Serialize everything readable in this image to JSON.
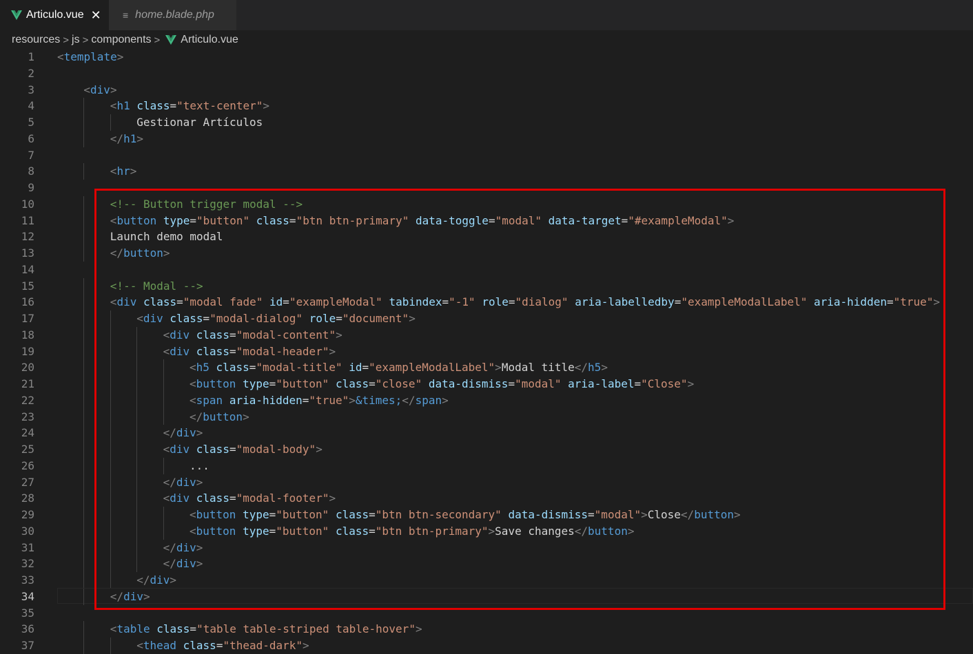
{
  "tabs": [
    {
      "label": "Articulo.vue",
      "icon": "vue-icon",
      "active": true
    },
    {
      "label": "home.blade.php",
      "icon": "lines-icon",
      "active": false
    }
  ],
  "breadcrumb": {
    "items": [
      "resources",
      "js",
      "components",
      "Articulo.vue"
    ],
    "separator": ">"
  },
  "editor": {
    "active_line": 34,
    "lines": [
      {
        "n": "1",
        "indent": 0,
        "tokens": [
          [
            "t",
            "<"
          ],
          [
            "tn",
            "template"
          ],
          [
            "t",
            ">"
          ]
        ]
      },
      {
        "n": "2",
        "indent": 0,
        "tokens": []
      },
      {
        "n": "3",
        "indent": 1,
        "tokens": [
          [
            "t",
            "<"
          ],
          [
            "tn",
            "div"
          ],
          [
            "t",
            ">"
          ]
        ]
      },
      {
        "n": "4",
        "indent": 2,
        "tokens": [
          [
            "t",
            "<"
          ],
          [
            "tn",
            "h1"
          ],
          [
            "p",
            " "
          ],
          [
            "a",
            "class"
          ],
          [
            "p",
            "="
          ],
          [
            "s",
            "\"text-center\""
          ],
          [
            "t",
            ">"
          ]
        ]
      },
      {
        "n": "5",
        "indent": 3,
        "tokens": [
          [
            "p",
            "Gestionar Artículos"
          ]
        ]
      },
      {
        "n": "6",
        "indent": 2,
        "tokens": [
          [
            "t",
            "</"
          ],
          [
            "tn",
            "h1"
          ],
          [
            "t",
            ">"
          ]
        ]
      },
      {
        "n": "7",
        "indent": 0,
        "tokens": []
      },
      {
        "n": "8",
        "indent": 2,
        "tokens": [
          [
            "t",
            "<"
          ],
          [
            "tn",
            "hr"
          ],
          [
            "t",
            ">"
          ]
        ]
      },
      {
        "n": "9",
        "indent": 0,
        "tokens": []
      },
      {
        "n": "10",
        "indent": 2,
        "tokens": [
          [
            "c",
            "<!-- Button trigger modal -->"
          ]
        ]
      },
      {
        "n": "11",
        "indent": 2,
        "tokens": [
          [
            "t",
            "<"
          ],
          [
            "tn",
            "button"
          ],
          [
            "p",
            " "
          ],
          [
            "a",
            "type"
          ],
          [
            "p",
            "="
          ],
          [
            "s",
            "\"button\""
          ],
          [
            "p",
            " "
          ],
          [
            "a",
            "class"
          ],
          [
            "p",
            "="
          ],
          [
            "s",
            "\"btn btn-primary\""
          ],
          [
            "p",
            " "
          ],
          [
            "a",
            "data-toggle"
          ],
          [
            "p",
            "="
          ],
          [
            "s",
            "\"modal\""
          ],
          [
            "p",
            " "
          ],
          [
            "a",
            "data-target"
          ],
          [
            "p",
            "="
          ],
          [
            "s",
            "\"#exampleModal\""
          ],
          [
            "t",
            ">"
          ]
        ]
      },
      {
        "n": "12",
        "indent": 2,
        "tokens": [
          [
            "p",
            "Launch demo modal"
          ]
        ]
      },
      {
        "n": "13",
        "indent": 2,
        "tokens": [
          [
            "t",
            "</"
          ],
          [
            "tn",
            "button"
          ],
          [
            "t",
            ">"
          ]
        ]
      },
      {
        "n": "14",
        "indent": 0,
        "tokens": []
      },
      {
        "n": "15",
        "indent": 2,
        "tokens": [
          [
            "c",
            "<!-- Modal -->"
          ]
        ]
      },
      {
        "n": "16",
        "indent": 2,
        "tokens": [
          [
            "t",
            "<"
          ],
          [
            "tn",
            "div"
          ],
          [
            "p",
            " "
          ],
          [
            "a",
            "class"
          ],
          [
            "p",
            "="
          ],
          [
            "s",
            "\"modal fade\""
          ],
          [
            "p",
            " "
          ],
          [
            "a",
            "id"
          ],
          [
            "p",
            "="
          ],
          [
            "s",
            "\"exampleModal\""
          ],
          [
            "p",
            " "
          ],
          [
            "a",
            "tabindex"
          ],
          [
            "p",
            "="
          ],
          [
            "s",
            "\"-1\""
          ],
          [
            "p",
            " "
          ],
          [
            "a",
            "role"
          ],
          [
            "p",
            "="
          ],
          [
            "s",
            "\"dialog\""
          ],
          [
            "p",
            " "
          ],
          [
            "a",
            "aria-labelledby"
          ],
          [
            "p",
            "="
          ],
          [
            "s",
            "\"exampleModalLabel\""
          ],
          [
            "p",
            " "
          ],
          [
            "a",
            "aria-hidden"
          ],
          [
            "p",
            "="
          ],
          [
            "s",
            "\"true\""
          ],
          [
            "t",
            ">"
          ]
        ]
      },
      {
        "n": "17",
        "indent": 3,
        "tokens": [
          [
            "t",
            "<"
          ],
          [
            "tn",
            "div"
          ],
          [
            "p",
            " "
          ],
          [
            "a",
            "class"
          ],
          [
            "p",
            "="
          ],
          [
            "s",
            "\"modal-dialog\""
          ],
          [
            "p",
            " "
          ],
          [
            "a",
            "role"
          ],
          [
            "p",
            "="
          ],
          [
            "s",
            "\"document\""
          ],
          [
            "t",
            ">"
          ]
        ]
      },
      {
        "n": "18",
        "indent": 4,
        "tokens": [
          [
            "t",
            "<"
          ],
          [
            "tn",
            "div"
          ],
          [
            "p",
            " "
          ],
          [
            "a",
            "class"
          ],
          [
            "p",
            "="
          ],
          [
            "s",
            "\"modal-content\""
          ],
          [
            "t",
            ">"
          ]
        ]
      },
      {
        "n": "19",
        "indent": 4,
        "tokens": [
          [
            "t",
            "<"
          ],
          [
            "tn",
            "div"
          ],
          [
            "p",
            " "
          ],
          [
            "a",
            "class"
          ],
          [
            "p",
            "="
          ],
          [
            "s",
            "\"modal-header\""
          ],
          [
            "t",
            ">"
          ]
        ]
      },
      {
        "n": "20",
        "indent": 5,
        "tokens": [
          [
            "t",
            "<"
          ],
          [
            "tn",
            "h5"
          ],
          [
            "p",
            " "
          ],
          [
            "a",
            "class"
          ],
          [
            "p",
            "="
          ],
          [
            "s",
            "\"modal-title\""
          ],
          [
            "p",
            " "
          ],
          [
            "a",
            "id"
          ],
          [
            "p",
            "="
          ],
          [
            "s",
            "\"exampleModalLabel\""
          ],
          [
            "t",
            ">"
          ],
          [
            "p",
            "Modal title"
          ],
          [
            "t",
            "</"
          ],
          [
            "tn",
            "h5"
          ],
          [
            "t",
            ">"
          ]
        ]
      },
      {
        "n": "21",
        "indent": 5,
        "tokens": [
          [
            "t",
            "<"
          ],
          [
            "tn",
            "button"
          ],
          [
            "p",
            " "
          ],
          [
            "a",
            "type"
          ],
          [
            "p",
            "="
          ],
          [
            "s",
            "\"button\""
          ],
          [
            "p",
            " "
          ],
          [
            "a",
            "class"
          ],
          [
            "p",
            "="
          ],
          [
            "s",
            "\"close\""
          ],
          [
            "p",
            " "
          ],
          [
            "a",
            "data-dismiss"
          ],
          [
            "p",
            "="
          ],
          [
            "s",
            "\"modal\""
          ],
          [
            "p",
            " "
          ],
          [
            "a",
            "aria-label"
          ],
          [
            "p",
            "="
          ],
          [
            "s",
            "\"Close\""
          ],
          [
            "t",
            ">"
          ]
        ]
      },
      {
        "n": "22",
        "indent": 5,
        "tokens": [
          [
            "t",
            "<"
          ],
          [
            "tn",
            "span"
          ],
          [
            "p",
            " "
          ],
          [
            "a",
            "aria-hidden"
          ],
          [
            "p",
            "="
          ],
          [
            "s",
            "\"true\""
          ],
          [
            "t",
            ">"
          ],
          [
            "e",
            "&times;"
          ],
          [
            "t",
            "</"
          ],
          [
            "tn",
            "span"
          ],
          [
            "t",
            ">"
          ]
        ]
      },
      {
        "n": "23",
        "indent": 5,
        "tokens": [
          [
            "t",
            "</"
          ],
          [
            "tn",
            "button"
          ],
          [
            "t",
            ">"
          ]
        ]
      },
      {
        "n": "24",
        "indent": 4,
        "tokens": [
          [
            "t",
            "</"
          ],
          [
            "tn",
            "div"
          ],
          [
            "t",
            ">"
          ]
        ]
      },
      {
        "n": "25",
        "indent": 4,
        "tokens": [
          [
            "t",
            "<"
          ],
          [
            "tn",
            "div"
          ],
          [
            "p",
            " "
          ],
          [
            "a",
            "class"
          ],
          [
            "p",
            "="
          ],
          [
            "s",
            "\"modal-body\""
          ],
          [
            "t",
            ">"
          ]
        ]
      },
      {
        "n": "26",
        "indent": 5,
        "tokens": [
          [
            "p",
            "..."
          ]
        ]
      },
      {
        "n": "27",
        "indent": 4,
        "tokens": [
          [
            "t",
            "</"
          ],
          [
            "tn",
            "div"
          ],
          [
            "t",
            ">"
          ]
        ]
      },
      {
        "n": "28",
        "indent": 4,
        "tokens": [
          [
            "t",
            "<"
          ],
          [
            "tn",
            "div"
          ],
          [
            "p",
            " "
          ],
          [
            "a",
            "class"
          ],
          [
            "p",
            "="
          ],
          [
            "s",
            "\"modal-footer\""
          ],
          [
            "t",
            ">"
          ]
        ]
      },
      {
        "n": "29",
        "indent": 5,
        "tokens": [
          [
            "t",
            "<"
          ],
          [
            "tn",
            "button"
          ],
          [
            "p",
            " "
          ],
          [
            "a",
            "type"
          ],
          [
            "p",
            "="
          ],
          [
            "s",
            "\"button\""
          ],
          [
            "p",
            " "
          ],
          [
            "a",
            "class"
          ],
          [
            "p",
            "="
          ],
          [
            "s",
            "\"btn btn-secondary\""
          ],
          [
            "p",
            " "
          ],
          [
            "a",
            "data-dismiss"
          ],
          [
            "p",
            "="
          ],
          [
            "s",
            "\"modal\""
          ],
          [
            "t",
            ">"
          ],
          [
            "p",
            "Close"
          ],
          [
            "t",
            "</"
          ],
          [
            "tn",
            "button"
          ],
          [
            "t",
            ">"
          ]
        ]
      },
      {
        "n": "30",
        "indent": 5,
        "tokens": [
          [
            "t",
            "<"
          ],
          [
            "tn",
            "button"
          ],
          [
            "p",
            " "
          ],
          [
            "a",
            "type"
          ],
          [
            "p",
            "="
          ],
          [
            "s",
            "\"button\""
          ],
          [
            "p",
            " "
          ],
          [
            "a",
            "class"
          ],
          [
            "p",
            "="
          ],
          [
            "s",
            "\"btn btn-primary\""
          ],
          [
            "t",
            ">"
          ],
          [
            "p",
            "Save changes"
          ],
          [
            "t",
            "</"
          ],
          [
            "tn",
            "button"
          ],
          [
            "t",
            ">"
          ]
        ]
      },
      {
        "n": "31",
        "indent": 4,
        "tokens": [
          [
            "t",
            "</"
          ],
          [
            "tn",
            "div"
          ],
          [
            "t",
            ">"
          ]
        ]
      },
      {
        "n": "32",
        "indent": 4,
        "tokens": [
          [
            "t",
            "</"
          ],
          [
            "tn",
            "div"
          ],
          [
            "t",
            ">"
          ]
        ]
      },
      {
        "n": "33",
        "indent": 3,
        "tokens": [
          [
            "t",
            "</"
          ],
          [
            "tn",
            "div"
          ],
          [
            "t",
            ">"
          ]
        ]
      },
      {
        "n": "34",
        "indent": 2,
        "tokens": [
          [
            "t",
            "</"
          ],
          [
            "tn",
            "div"
          ],
          [
            "t",
            ">"
          ]
        ]
      },
      {
        "n": "35",
        "indent": 0,
        "tokens": []
      },
      {
        "n": "36",
        "indent": 2,
        "tokens": [
          [
            "t",
            "<"
          ],
          [
            "tn",
            "table"
          ],
          [
            "p",
            " "
          ],
          [
            "a",
            "class"
          ],
          [
            "p",
            "="
          ],
          [
            "s",
            "\"table table-striped table-hover\""
          ],
          [
            "t",
            ">"
          ]
        ]
      },
      {
        "n": "37",
        "indent": 3,
        "tokens": [
          [
            "t",
            "<"
          ],
          [
            "tn",
            "thead"
          ],
          [
            "p",
            " "
          ],
          [
            "a",
            "class"
          ],
          [
            "p",
            "="
          ],
          [
            "s",
            "\"thead-dark\""
          ],
          [
            "t",
            ">"
          ]
        ]
      }
    ]
  },
  "colors": {
    "editor_bg": "#1e1e1e",
    "tag_bracket": "#808080",
    "tag_name": "#569cd6",
    "attribute": "#9cdcfe",
    "string": "#ce9178",
    "comment": "#6a9955",
    "text": "#d4d4d4",
    "highlight_box": "#e00000",
    "vue_green": "#41b883"
  }
}
